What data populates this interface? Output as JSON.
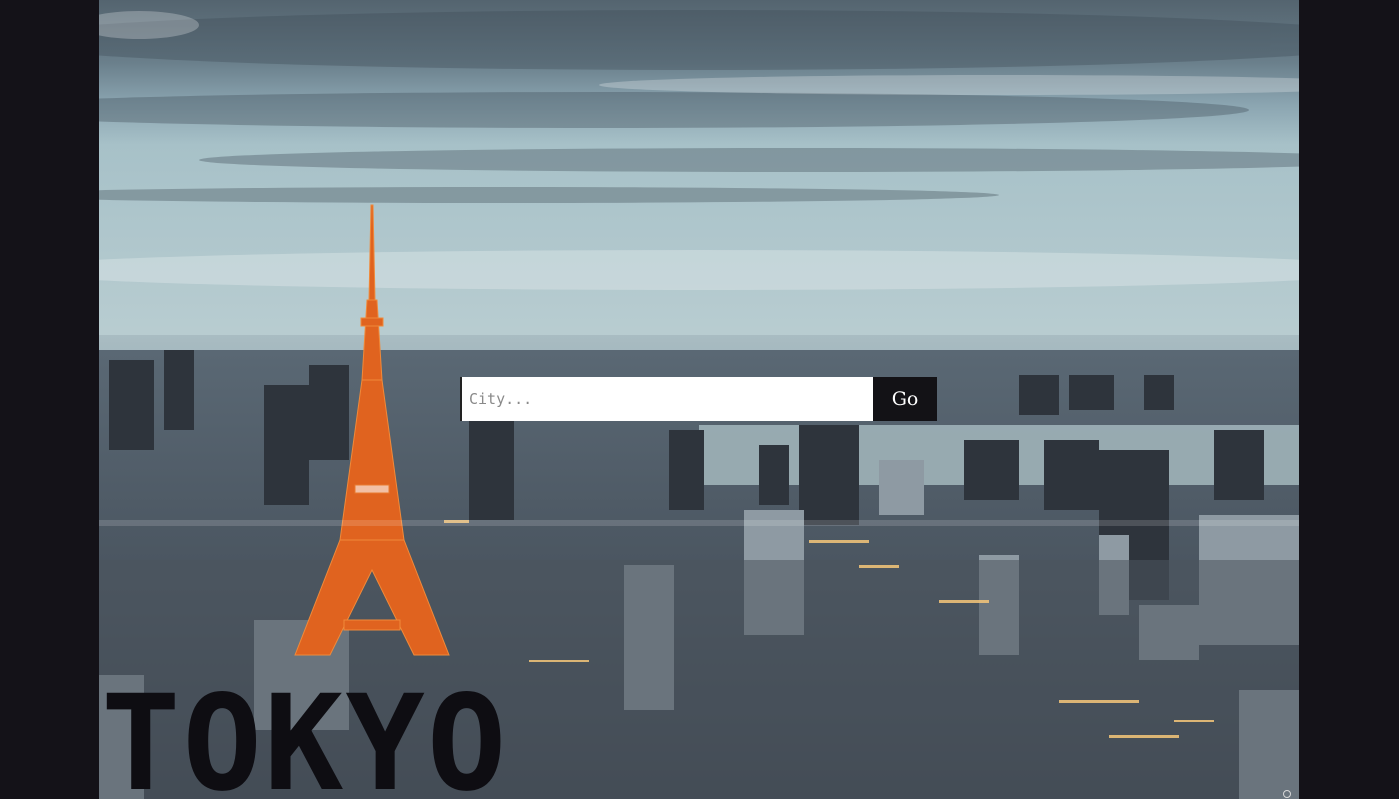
{
  "search": {
    "placeholder": "City...",
    "value": "",
    "button_label": "Go"
  },
  "hero": {
    "city_name": "TOKYO",
    "background": "tokyo-skyline-photo"
  },
  "colors": {
    "page_background": "#141218",
    "button_background": "#131216",
    "button_text": "#ffffff",
    "city_name_text": "#0e0d12",
    "tower_orange": "#e0631f"
  }
}
